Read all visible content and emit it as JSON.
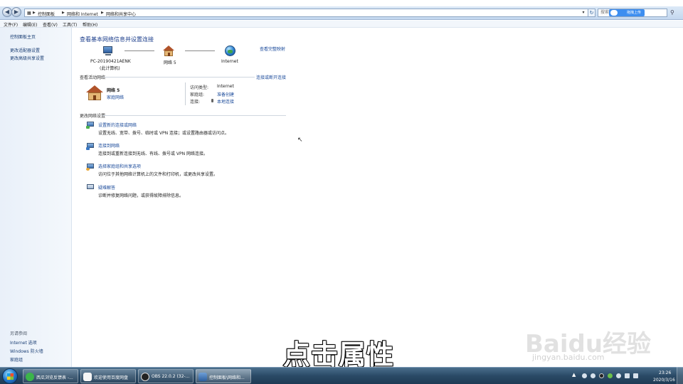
{
  "address": {
    "crumbs": [
      "控制面板",
      "网络和 Internet",
      "网络和共享中心"
    ],
    "search_placeholder": "搜索",
    "upload_label": "拖拽上传"
  },
  "menu": [
    "文件(F)",
    "编辑(E)",
    "查看(V)",
    "工具(T)",
    "帮助(H)"
  ],
  "nav": {
    "links": [
      "控制面板主页",
      "更改适配器设置",
      "更改高级共享设置"
    ],
    "see_also_title": "另请参阅",
    "see_also": [
      "Internet 选项",
      "Windows 防火墙",
      "家庭组"
    ]
  },
  "main": {
    "title": "查看基本网络信息并设置连接",
    "full_map_link": "查看完整映射",
    "map": {
      "computer": "PC-20190421AENK",
      "computer_sub": "(此计算机)",
      "network": "网络  5",
      "internet": "Internet"
    },
    "active_title": "查看活动网络",
    "connect_link": "连接或断开连接",
    "active": {
      "name": "网络  5",
      "type_link": "家庭网络",
      "access_key": "访问类型:",
      "access_val": "Internet",
      "homegroup_key": "家庭组:",
      "homegroup_val": "准备创建",
      "conn_key": "连接:",
      "conn_val": "本地连接"
    },
    "change_title": "更改网络设置",
    "tasks": [
      {
        "link": "设置新的连接或网络",
        "desc": "设置无线、宽带、拨号、临时或 VPN 连接；或设置路由器或访问点。"
      },
      {
        "link": "连接到网络",
        "desc": "连接到或重新连接到无线、有线、拨号或 VPN 网络连接。"
      },
      {
        "link": "选择家庭组和共享选项",
        "desc": "访问位于其他网络计算机上的文件和打印机，或更改共享设置。"
      },
      {
        "link": "疑难解答",
        "desc": "诊断并修复网络问题，或获得故障排除信息。"
      }
    ]
  },
  "overlay": {
    "subtitle": "点击属性",
    "watermark": "Baidu经验",
    "watermark_url": "jingyan.baidu.com"
  },
  "taskbar": {
    "items": [
      "西瓜浏览反馈表 -...",
      "欢迎使用百度网盘",
      "OBS 22.0.2 (32-...",
      "控制面板\\网络和..."
    ],
    "time": "23:26",
    "date": "2020/3/16"
  },
  "icons": {
    "computer": "computer-icon",
    "network": "house-icon",
    "internet": "globe-icon",
    "help": "help-icon"
  },
  "colors": {
    "link": "#1a4a9a",
    "title": "#1d3f8c",
    "taskbar": "#2a4a66"
  }
}
